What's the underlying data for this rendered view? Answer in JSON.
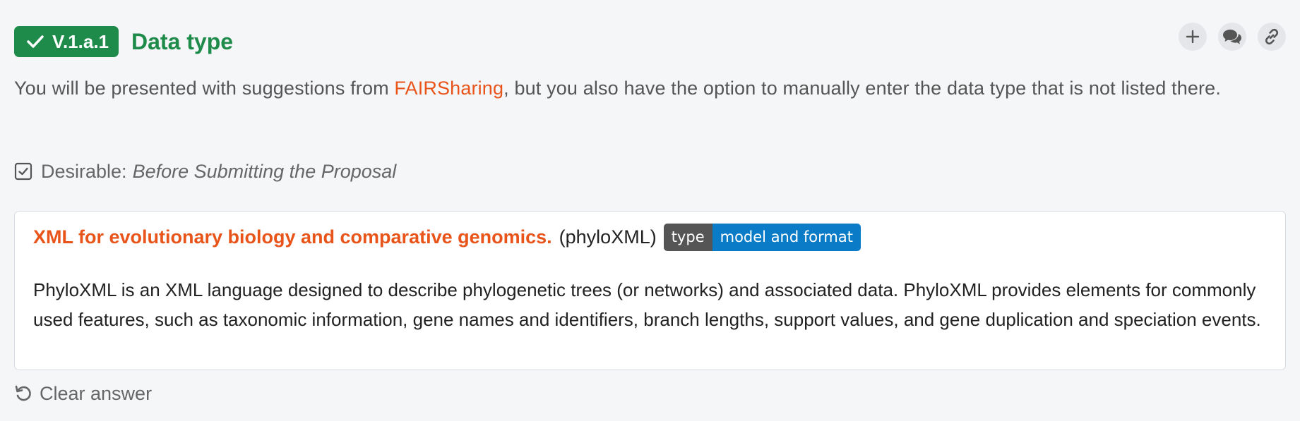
{
  "question": {
    "badge_label": "V.1.a.1",
    "title": "Data type",
    "description_before": "You will be presented with suggestions from ",
    "description_link": "FAIRSharing",
    "description_after": ", but you also have the option to manually enter the data type that is not listed there.",
    "desirable_label": "Desirable:",
    "desirable_value": "Before Submitting the Proposal"
  },
  "actions": {
    "icons": [
      "plus-icon",
      "comments-icon",
      "link-icon"
    ]
  },
  "answer": {
    "title": "XML for evolutionary biology and comparative genomics.",
    "abbreviation": "(phyloXML)",
    "tag_key": "type",
    "tag_value": "model and format",
    "description": "PhyloXML is an XML language designed to describe phylogenetic trees (or networks) and associated data. PhyloXML provides elements for commonly used features, such as taxonomic information, gene names and identifiers, branch lengths, support values, and gene duplication and speciation events."
  },
  "clear_answer_label": "Clear answer",
  "colors": {
    "success": "#1e8b4a",
    "link": "#e8541a",
    "tag_value_bg": "#0a7bc6",
    "tag_key_bg": "#555555"
  }
}
